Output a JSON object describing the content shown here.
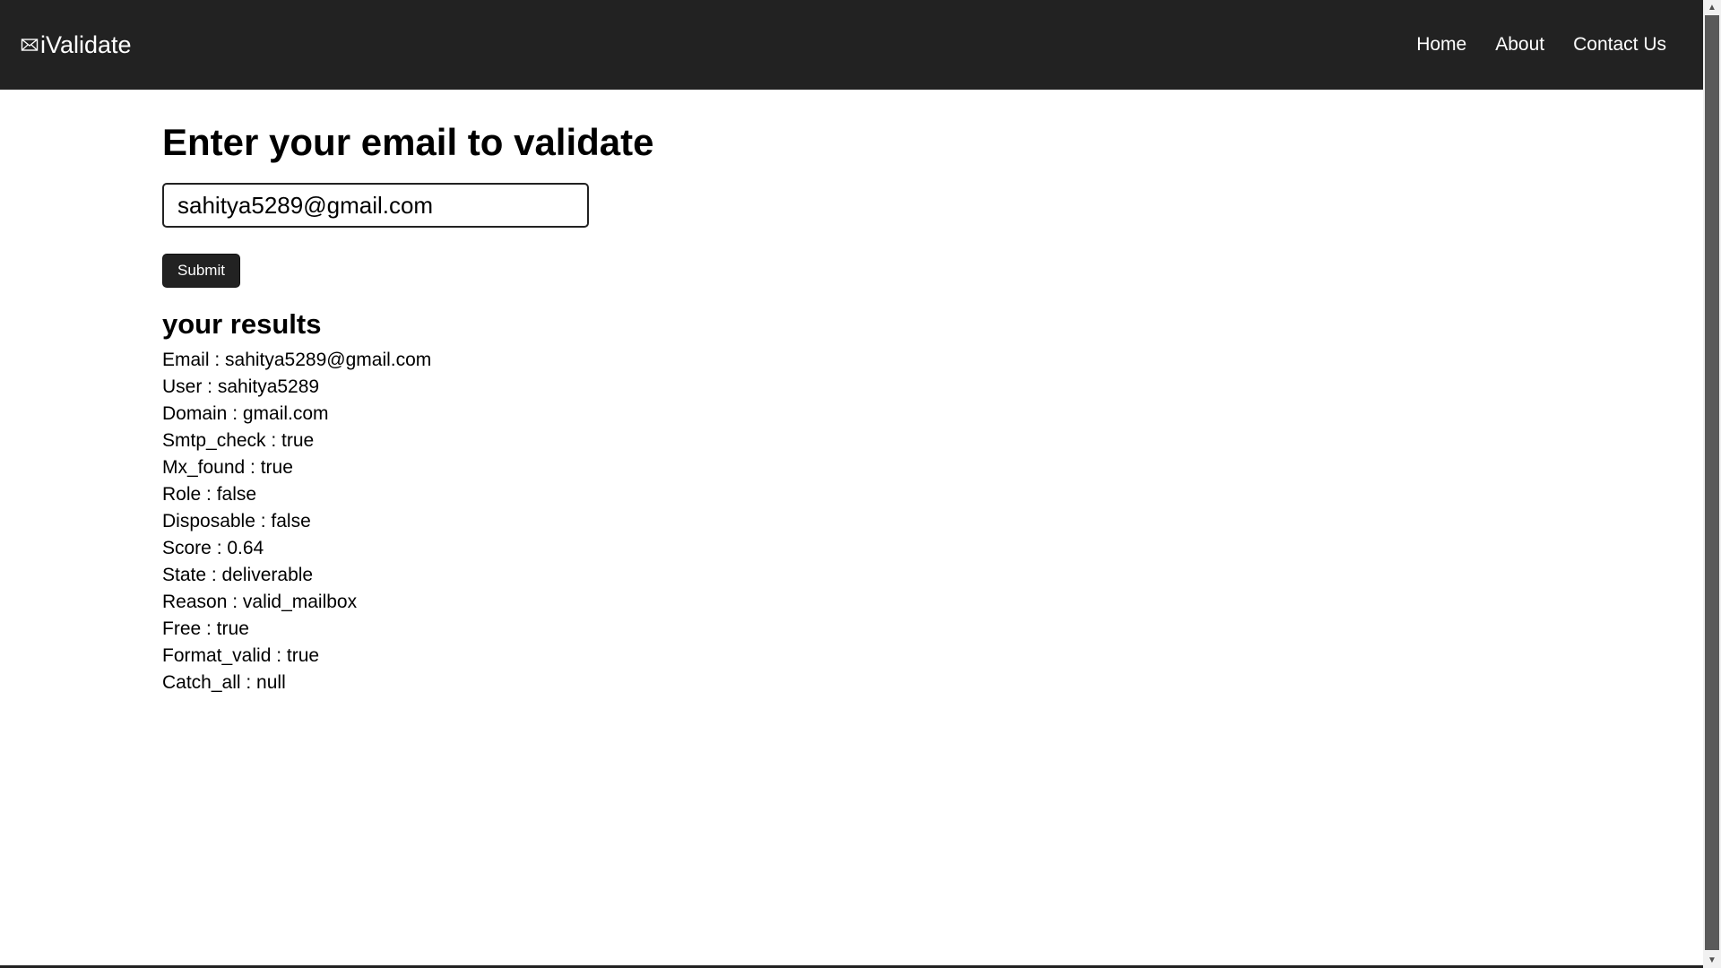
{
  "brand": {
    "icon": "envelope-icon",
    "name": "iValidate"
  },
  "nav": {
    "items": [
      {
        "label": "Home"
      },
      {
        "label": "About"
      },
      {
        "label": "Contact Us"
      }
    ]
  },
  "form": {
    "heading": "Enter your email to validate",
    "email_value": "sahitya5289@gmail.com",
    "submit_label": "Submit"
  },
  "results": {
    "title": "your results",
    "rows": [
      {
        "text": "Email : sahitya5289@gmail.com"
      },
      {
        "text": "User : sahitya5289"
      },
      {
        "text": "Domain : gmail.com"
      },
      {
        "text": "Smtp_check : true"
      },
      {
        "text": "Mx_found : true"
      },
      {
        "text": "Role : false"
      },
      {
        "text": "Disposable : false"
      },
      {
        "text": "Score : 0.64"
      },
      {
        "text": "State : deliverable"
      },
      {
        "text": "Reason : valid_mailbox"
      },
      {
        "text": "Free : true"
      },
      {
        "text": "Format_valid : true"
      },
      {
        "text": "Catch_all : null"
      }
    ]
  },
  "scrollbar": {
    "up_icon": "arrow-up-icon",
    "down_icon": "arrow-down-icon"
  },
  "colors": {
    "navbar": "#222222",
    "button": "#222222",
    "text": "#000000",
    "background": "#ffffff"
  }
}
